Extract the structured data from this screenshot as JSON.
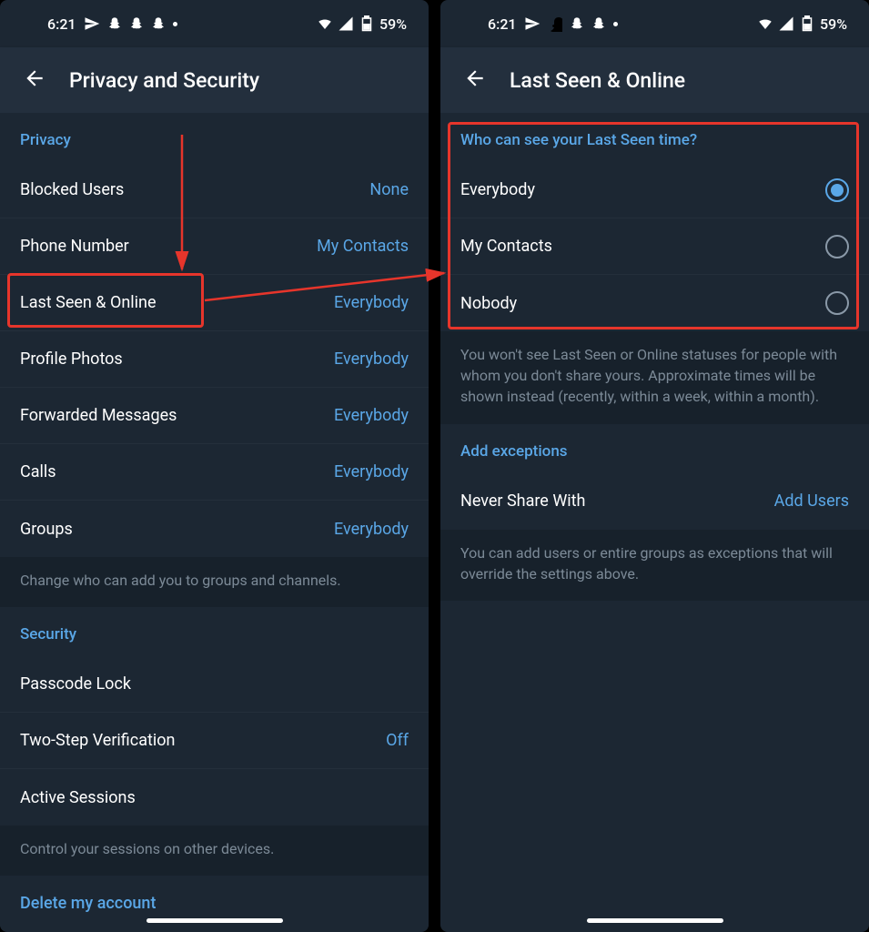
{
  "statusbar": {
    "time": "6:21",
    "battery": "59%"
  },
  "left": {
    "header_title": "Privacy and Security",
    "privacy_header": "Privacy",
    "rows": {
      "blocked": {
        "label": "Blocked Users",
        "value": "None"
      },
      "phone": {
        "label": "Phone Number",
        "value": "My Contacts"
      },
      "lastseen": {
        "label": "Last Seen & Online",
        "value": "Everybody"
      },
      "photos": {
        "label": "Profile Photos",
        "value": "Everybody"
      },
      "fwd": {
        "label": "Forwarded Messages",
        "value": "Everybody"
      },
      "calls": {
        "label": "Calls",
        "value": "Everybody"
      },
      "groups": {
        "label": "Groups",
        "value": "Everybody"
      }
    },
    "privacy_footer": "Change who can add you to groups and channels.",
    "security_header": "Security",
    "security_rows": {
      "passcode": {
        "label": "Passcode Lock",
        "value": ""
      },
      "twostep": {
        "label": "Two-Step Verification",
        "value": "Off"
      },
      "sessions": {
        "label": "Active Sessions",
        "value": ""
      }
    },
    "security_footer": "Control your sessions on other devices.",
    "delete_link": "Delete my account"
  },
  "right": {
    "header_title": "Last Seen & Online",
    "who_header": "Who can see your Last Seen time?",
    "options": {
      "everybody": "Everybody",
      "contacts": "My Contacts",
      "nobody": "Nobody"
    },
    "who_footer": "You won't see Last Seen or Online statuses for people with whom you don't share yours. Approximate times will be shown instead (recently, within a week, within a month).",
    "exceptions_header": "Add exceptions",
    "never_share": {
      "label": "Never Share With",
      "value": "Add Users"
    },
    "exceptions_footer": "You can add users or entire groups as exceptions that will override the settings above."
  }
}
